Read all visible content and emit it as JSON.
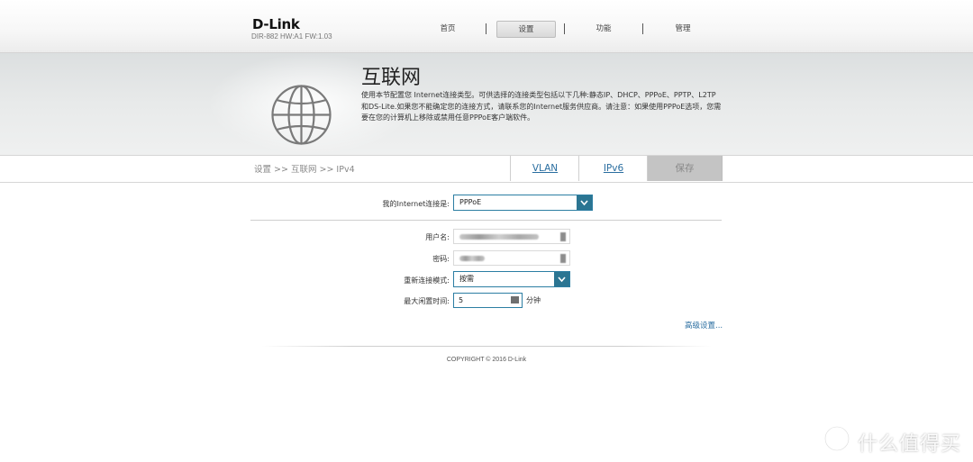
{
  "header": {
    "brand": "D-Link",
    "model_info": "DIR-882 HW:A1 FW:1.03",
    "nav": [
      {
        "label": "首页",
        "active": false
      },
      {
        "label": "设置",
        "active": true
      },
      {
        "label": "功能",
        "active": false
      },
      {
        "label": "管理",
        "active": false
      }
    ]
  },
  "banner": {
    "title": "互联网",
    "description": "使用本节配置您 Internet连接类型。可供选择的连接类型包括以下几种:静态IP、DHCP、PPPoE、PPTP、L2TP和DS-Lite.如果您不能确定您的连接方式，请联系您的Internet服务供应商。请注意：如果使用PPPoE选项，您需要在您的计算机上移除或禁用任意PPPoE客户端软件。",
    "icon": "globe-icon"
  },
  "breadcrumb": "设置 >> 互联网 >> IPv4",
  "tabs": {
    "vlan": "VLAN",
    "ipv6": "IPv6",
    "save": "保存"
  },
  "form": {
    "connection_type_label": "我的Internet连接是:",
    "connection_type_value": "PPPoE",
    "username_label": "用户名:",
    "password_label": "密码:",
    "reconnect_label": "重新连接模式:",
    "reconnect_value": "按需",
    "idle_label": "最大闲置时间:",
    "idle_value": "5",
    "idle_unit": "分钟"
  },
  "advanced_link": "高级设置...",
  "footer": {
    "copyright": "COPYRIGHT © 2016 D-Link"
  },
  "watermark": {
    "text": "什么值得买",
    "icon": "smzdm-logo-icon"
  },
  "colors": {
    "accent": "#2b7592",
    "link": "#2a6ea0",
    "save_bg": "#c4c4c4"
  }
}
